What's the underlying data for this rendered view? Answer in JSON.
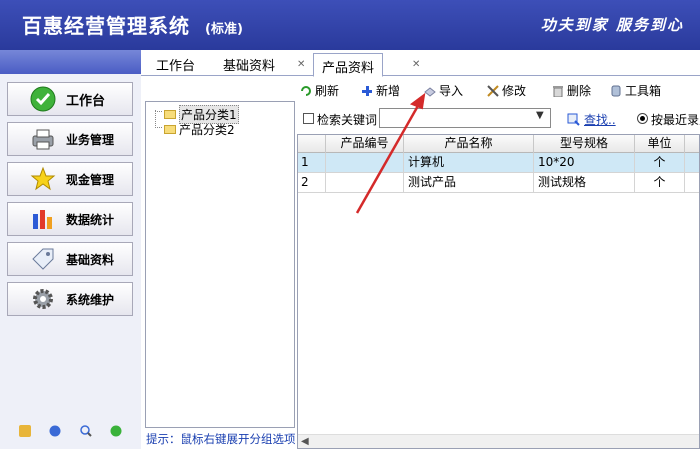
{
  "header": {
    "title": "百惠经营管理系统",
    "edition": "(标准)",
    "slogan": "功夫到家 服务到心"
  },
  "sidebar": {
    "items": [
      {
        "label": "工作台",
        "icon": "check-circle-icon"
      },
      {
        "label": "业务管理",
        "icon": "printer-icon"
      },
      {
        "label": "现金管理",
        "icon": "star-icon"
      },
      {
        "label": "数据统计",
        "icon": "bar-chart-icon"
      },
      {
        "label": "基础资料",
        "icon": "tag-icon"
      },
      {
        "label": "系统维护",
        "icon": "gear-icon"
      }
    ],
    "footer_icons": [
      "key-icon",
      "clock-icon",
      "search-icon",
      "exit-icon"
    ]
  },
  "tabs": [
    {
      "label": "工作台"
    },
    {
      "label": "基础资料"
    },
    {
      "label": "产品资料"
    }
  ],
  "tree": {
    "items": [
      {
        "label": "产品分类1"
      },
      {
        "label": "产品分类2"
      }
    ]
  },
  "tip": "提示：鼠标右键展开分组选项",
  "toolbar": {
    "refresh": "刷新",
    "add": "新增",
    "import": "导入",
    "edit": "修改",
    "delete": "删除",
    "tools": "工具箱"
  },
  "search": {
    "checkbox_label": "检索关键词",
    "keyword_value": "",
    "find_label": "查找..",
    "radio_label": "按最近录入"
  },
  "grid": {
    "columns": [
      "产品编号",
      "产品名称",
      "型号规格",
      "单位"
    ],
    "rows": [
      {
        "index": "1",
        "code": "",
        "name": "计算机",
        "spec": "10*20",
        "unit": "个"
      },
      {
        "index": "2",
        "code": "",
        "name": "测试产品",
        "spec": "测试规格",
        "unit": "个"
      }
    ]
  },
  "colors": {
    "header_bg": "#2f40a6",
    "selected_row": "#cfe8f6",
    "link": "#1a3fb0",
    "arrow": "#d42a2a"
  }
}
